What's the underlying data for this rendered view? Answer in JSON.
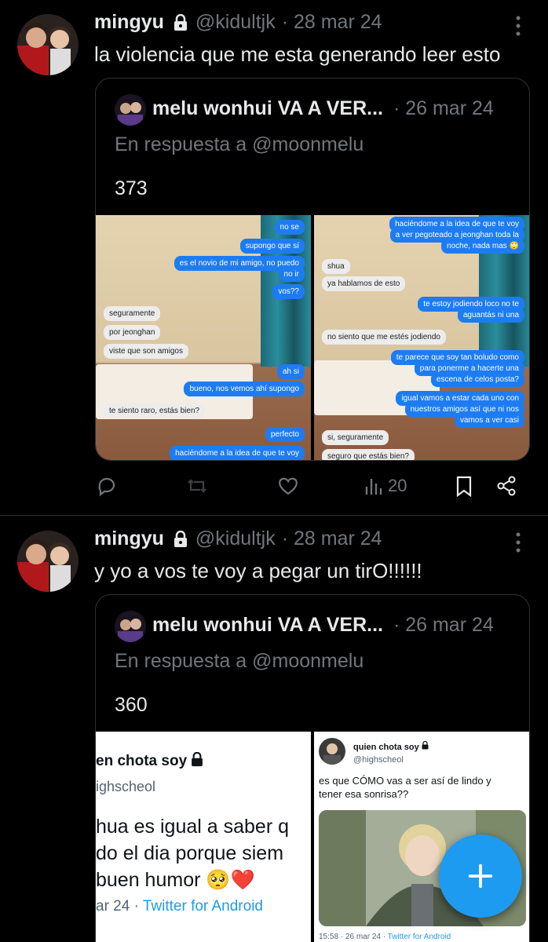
{
  "tweets": [
    {
      "name": "mingyu",
      "handle": "@kidultjk",
      "date": "· 28 mar 24",
      "text": "la violencia que me esta generando leer esto",
      "quote": {
        "name": "melu wonhui VA A VER...",
        "date": "· 26 mar 24",
        "reply_prefix": "En respuesta a ",
        "reply_to": "@moonmelu",
        "text": "373",
        "left_chat": [
          {
            "text": "no se",
            "side": "out"
          },
          {
            "text": "supongo que sí",
            "side": "out"
          },
          {
            "text": "es el novio de mi amigo, no puedo",
            "side": "out"
          },
          {
            "text": "no ir",
            "side": "out"
          },
          {
            "text": "vos??",
            "side": "out"
          },
          {
            "text": "seguramente",
            "side": "in"
          },
          {
            "text": "por jeonghan",
            "side": "in"
          },
          {
            "text": "viste que son amigos",
            "side": "in"
          },
          {
            "text": "ah si",
            "side": "out"
          },
          {
            "text": "bueno, nos vemos ahí supongo",
            "side": "out"
          },
          {
            "text": "te siento raro, estás bien?",
            "side": "in"
          },
          {
            "text": "perfecto",
            "side": "out"
          },
          {
            "text": "haciéndome a la idea de que te voy",
            "side": "out"
          }
        ],
        "right_chat": [
          {
            "text": "haciéndome a la idea de que te voy",
            "side": "out"
          },
          {
            "text": "a ver pegoteado a jeonghan toda la",
            "side": "out"
          },
          {
            "text": "noche, nada mas 🙄",
            "side": "out"
          },
          {
            "text": "shua",
            "side": "in"
          },
          {
            "text": "ya hablamos de esto",
            "side": "in"
          },
          {
            "text": "te estoy jodiendo loco no te",
            "side": "out"
          },
          {
            "text": "aguantás ni una",
            "side": "out"
          },
          {
            "text": "no siento que me estés jodiendo",
            "side": "in"
          },
          {
            "text": "te parece que soy tan boludo como",
            "side": "out"
          },
          {
            "text": "para ponerme a hacerte una",
            "side": "out"
          },
          {
            "text": "escena de celos posta?",
            "side": "out"
          },
          {
            "text": "igual vamos a estar cada uno con",
            "side": "out"
          },
          {
            "text": "nuestros amigos así que ni nos",
            "side": "out"
          },
          {
            "text": "vamos a ver casi",
            "side": "out"
          },
          {
            "text": "si, seguramente",
            "side": "in"
          },
          {
            "text": "seguro que estás bien?",
            "side": "in"
          }
        ]
      },
      "actions": {
        "views": "20"
      }
    },
    {
      "name": "mingyu",
      "handle": "@kidultjk",
      "date": "· 28 mar 24",
      "text": "y yo a vos te voy a pegar un tirO!!!!!!",
      "quote": {
        "name": "melu wonhui VA A VER...",
        "date": "· 26 mar 24",
        "reply_prefix": "En respuesta a ",
        "reply_to": "@moonmelu",
        "text": "360",
        "left_img": {
          "name": "en chota soy",
          "handle": "ighscheol",
          "line1": "hua es igual a saber q",
          "line2": "do el dia porque siem",
          "line3": "buen humor 🥺❤️",
          "meta_date": "ar 24 · ",
          "meta_client": "Twitter for Android"
        },
        "right_img": {
          "name": "quien chota soy",
          "handle": "@highscheol",
          "line1": "es que CÓMO vas a ser así de lindo y",
          "line2": "tener esa sonrisa??",
          "meta_date": "15:58 · 26 mar 24 · ",
          "meta_client": "Twitter for Android"
        }
      }
    }
  ],
  "colors": {
    "accent": "#1d9bf0",
    "muted": "#71767b",
    "border": "#2f3336",
    "bubble_out": "#1d7cf2"
  }
}
